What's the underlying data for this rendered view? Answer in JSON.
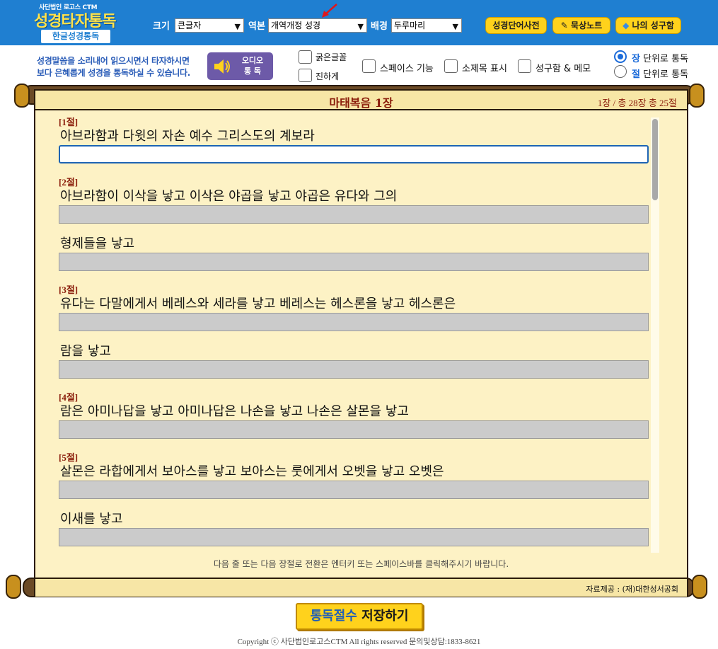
{
  "header": {
    "logo_sub": "사단법인 로고스 CTM",
    "logo_main": "성경타자통독",
    "logo_badge": "한글성경통독",
    "size_label": "크기",
    "size_value": "큰글자",
    "version_label": "역본",
    "version_value": "개역개정 성경",
    "background_label": "배경",
    "background_value": "두루마리",
    "buttons": {
      "dictionary": "성경단어사전",
      "meditation": "묵상노트",
      "verses": "나의 성구함"
    }
  },
  "options": {
    "intro_line1": "성경말씀을 소리내어 읽으시면서 타자하시면",
    "intro_line2": "보다 은혜롭게 성경을 통독하실 수 있습니다.",
    "audio_label_1": "오디오",
    "audio_label_2": "통 독",
    "bold_font": "굵은글꼴",
    "darker": "진하게",
    "space_feature": "스페이스 기능",
    "subtitle_display": "소제목 표시",
    "verse_box_memo": "성구함 & 메모",
    "radio_chapter_hl": "장",
    "radio_chapter": " 단위로 통독",
    "radio_verse_hl": "절",
    "radio_verse": " 단위로 통독"
  },
  "scroll": {
    "chapter_title": "마태복음 1장",
    "chapter_info": "1장 / 총 28장   총 25절",
    "verses": [
      {
        "label": "[1절]",
        "lines": [
          "아브라함과 다윗의 자손 예수 그리스도의 계보라"
        ]
      },
      {
        "label": "[2절]",
        "lines": [
          "아브라함이 이삭을 낳고 이삭은 야곱을 낳고 야곱은 유다와 그의",
          "형제들을 낳고"
        ]
      },
      {
        "label": "[3절]",
        "lines": [
          "유다는 다말에게서 베레스와 세라를 낳고 베레스는 헤스론을 낳고 헤스론은",
          "람을 낳고"
        ]
      },
      {
        "label": "[4절]",
        "lines": [
          "람은 아미나답을 낳고 아미나답은 나손을 낳고 나손은 살몬을 낳고"
        ]
      },
      {
        "label": "[5절]",
        "lines": [
          "살몬은 라합에게서 보아스를 낳고 보아스는 룻에게서 오벳을 낳고 오벳은",
          "이새를 낳고"
        ]
      }
    ],
    "note": "다음 줄 또는 다음 장절로 전환은 엔터키 또는 스페이스바를 클릭해주시기 바랍니다.",
    "source": "자료제공 : (재)대한성서공회"
  },
  "footer": {
    "save_part1": "통독절수",
    "save_part2": "저장하기",
    "copyright": "Copyright ⓒ 사단법인로고스CTM All rights reserved 문의및상담:1833-8621"
  },
  "colors": {
    "header_blue": "#1f7fd1",
    "logo_yellow": "#ffe24a",
    "pill_yellow": "#ffd21c",
    "audio_purple": "#6d5aa8",
    "parchment": "#fdf2c5",
    "verse_red": "#8a1c0a",
    "input_gray": "#cbcbcb"
  }
}
